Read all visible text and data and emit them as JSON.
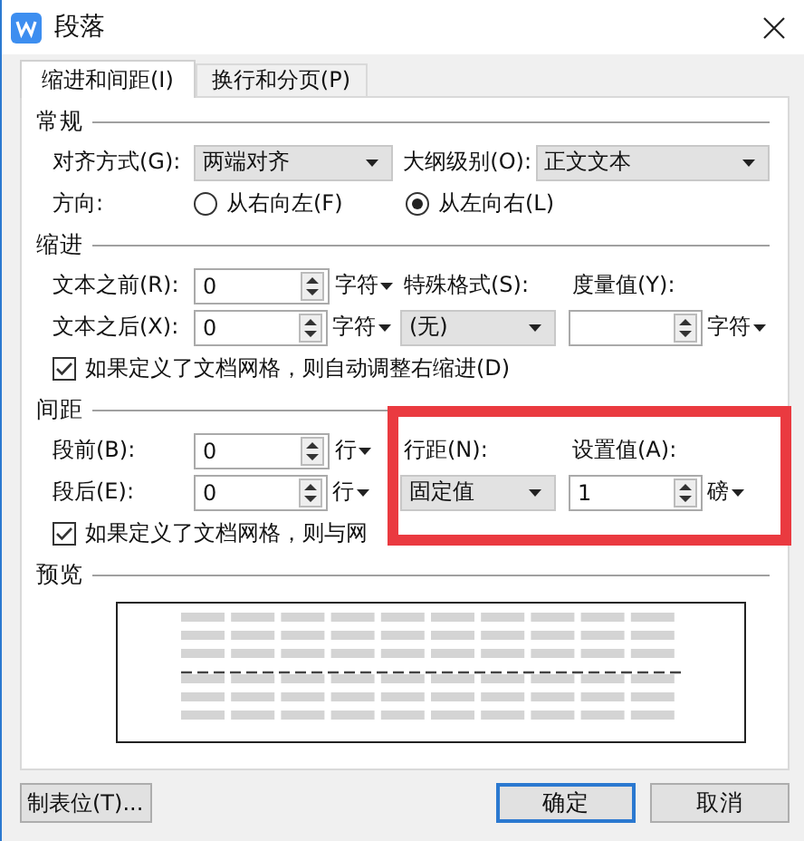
{
  "window": {
    "title": "段落"
  },
  "tabs": [
    {
      "label": "缩进和间距(I)",
      "selected": true
    },
    {
      "label": "换行和分页(P)",
      "selected": false
    }
  ],
  "general": {
    "title": "常规",
    "alignment": {
      "label": "对齐方式(G):",
      "value": "两端对齐"
    },
    "outline_level": {
      "label": "大纲级别(O):",
      "value": "正文文本"
    },
    "direction": {
      "label": "方向:",
      "options": [
        {
          "label": "从右向左(F)",
          "selected": false
        },
        {
          "label": "从左向右(L)",
          "selected": true
        }
      ]
    }
  },
  "indent": {
    "title": "缩进",
    "before": {
      "label": "文本之前(R):",
      "value": "0",
      "unit": "字符"
    },
    "after": {
      "label": "文本之后(X):",
      "value": "0",
      "unit": "字符"
    },
    "special": {
      "label": "特殊格式(S):",
      "value": "(无)"
    },
    "measure": {
      "label": "度量值(Y):",
      "unit": "字符"
    },
    "checkbox": {
      "label": "如果定义了文档网格，则自动调整右缩进(D)",
      "checked": true
    }
  },
  "spacing": {
    "title": "间距",
    "before": {
      "label": "段前(B):",
      "value": "0",
      "unit": "行"
    },
    "after": {
      "label": "段后(E):",
      "value": "0",
      "unit": "行"
    },
    "line_spacing": {
      "label": "行距(N):",
      "value": "固定值"
    },
    "set_value": {
      "label": "设置值(A):",
      "value": "1",
      "unit": "磅"
    },
    "checkbox": {
      "label": "如果定义了文档网格，则与网",
      "checked": true
    }
  },
  "preview": {
    "title": "预览"
  },
  "buttons": [
    {
      "label": "制表位(T)...",
      "kind": "secondary"
    },
    {
      "label": "确定",
      "kind": "default"
    },
    {
      "label": "取消",
      "kind": "secondary"
    }
  ]
}
